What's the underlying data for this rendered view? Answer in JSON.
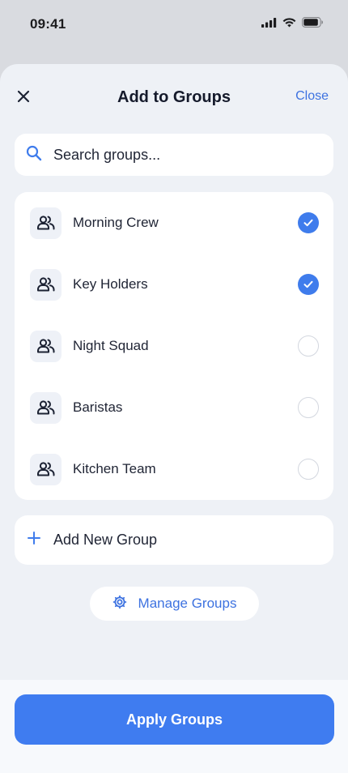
{
  "status_bar": {
    "time": "09:41",
    "icons": [
      "cellular-signal-icon",
      "wifi-icon",
      "battery-icon"
    ]
  },
  "sheet": {
    "title": "Add to Groups",
    "close_label": "Close",
    "close_icon": "close-icon"
  },
  "search": {
    "placeholder": "Search groups...",
    "value": "",
    "icon": "search-icon"
  },
  "groups": [
    {
      "name": "Morning Crew",
      "selected": true,
      "icon": "people-icon"
    },
    {
      "name": "Key Holders",
      "selected": true,
      "icon": "people-icon"
    },
    {
      "name": "Night Squad",
      "selected": false,
      "icon": "people-icon"
    },
    {
      "name": "Baristas",
      "selected": false,
      "icon": "people-icon"
    },
    {
      "name": "Kitchen Team",
      "selected": false,
      "icon": "people-icon"
    }
  ],
  "add_group": {
    "label": "Add New Group",
    "icon": "plus-icon"
  },
  "manage": {
    "label": "Manage Groups",
    "icon": "gear-icon"
  },
  "apply": {
    "label": "Apply Groups"
  },
  "colors": {
    "accent": "#3f7cec",
    "link": "#3d72e0",
    "sheet_bg": "#eef1f6",
    "backdrop": "#d9dbe0"
  }
}
